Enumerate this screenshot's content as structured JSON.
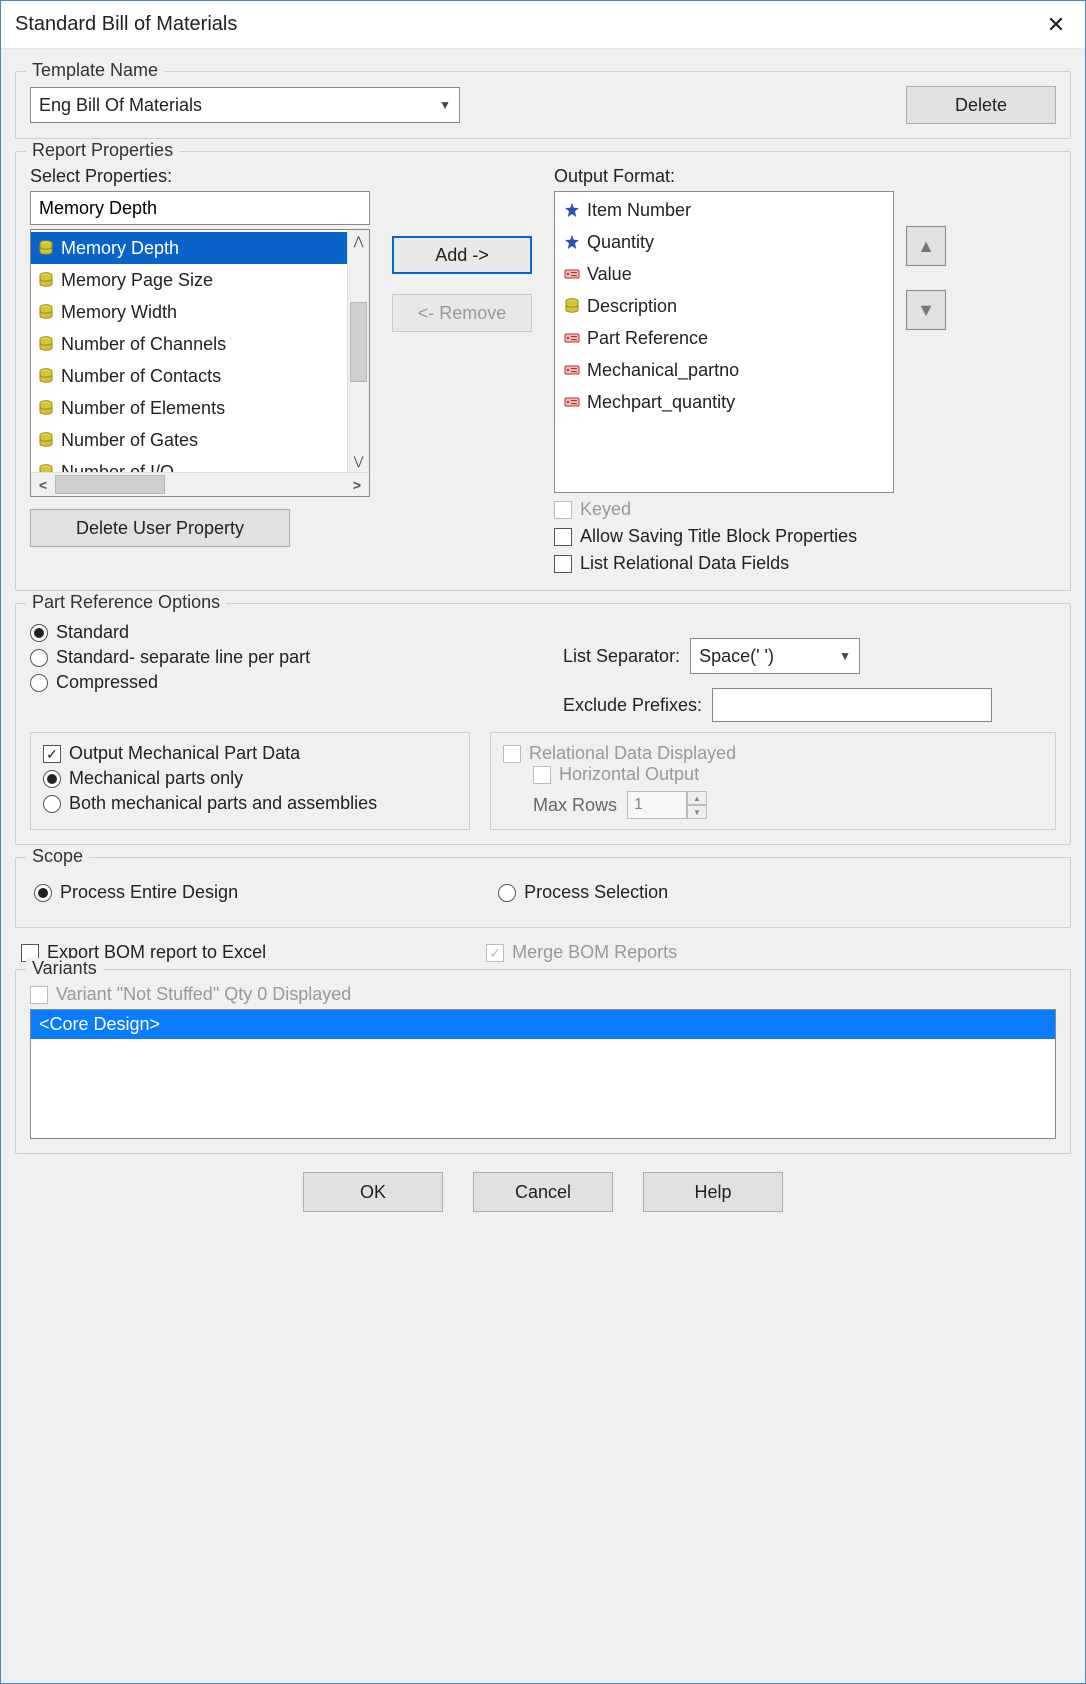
{
  "window": {
    "title": "Standard Bill of Materials"
  },
  "template": {
    "group_label": "Template Name",
    "value": "Eng Bill Of Materials",
    "delete_label": "Delete"
  },
  "report": {
    "group_label": "Report Properties",
    "select_label": "Select Properties:",
    "search_value": "Memory Depth",
    "items": [
      "Memory Depth",
      "Memory Page Size",
      "Memory Width",
      "Number of Channels",
      "Number of Contacts",
      "Number of Elements",
      "Number of Gates",
      "Number of I/O"
    ],
    "selected_index": 0,
    "add_label": "Add ->",
    "remove_label": "<- Remove",
    "output_label": "Output Format:",
    "output_items": [
      {
        "icon": "star",
        "label": "Item Number"
      },
      {
        "icon": "star",
        "label": "Quantity"
      },
      {
        "icon": "tag",
        "label": "Value"
      },
      {
        "icon": "db",
        "label": "Description"
      },
      {
        "icon": "tag",
        "label": "Part Reference"
      },
      {
        "icon": "tag",
        "label": "Mechanical_partno"
      },
      {
        "icon": "tag",
        "label": "Mechpart_quantity"
      }
    ],
    "delete_user_prop_label": "Delete User Property",
    "keyed_label": "Keyed",
    "allow_title_label": "Allow Saving Title Block Properties",
    "list_rel_label": "List Relational Data Fields"
  },
  "partref": {
    "group_label": "Part Reference Options",
    "standard_label": "Standard",
    "sep_line_label": "Standard- separate line per part",
    "compressed_label": "Compressed",
    "list_sep_label": "List Separator:",
    "list_sep_value": "Space(' ')",
    "exclude_label": "Exclude Prefixes:",
    "exclude_value": "",
    "out_mech_label": "Output Mechanical Part Data",
    "mech_only_label": "Mechanical parts only",
    "both_label": "Both mechanical parts and assemblies",
    "rel_disp_label": "Relational Data Displayed",
    "horiz_label": "Horizontal Output",
    "maxrows_label": "Max Rows",
    "maxrows_value": "1"
  },
  "scope": {
    "group_label": "Scope",
    "entire_label": "Process Entire Design",
    "selection_label": "Process Selection"
  },
  "export": {
    "export_label": "Export BOM report to Excel",
    "merge_label": "Merge BOM Reports"
  },
  "variants": {
    "group_label": "Variants",
    "not_stuffed_label": "Variant \"Not Stuffed\" Qty 0 Displayed",
    "items": [
      "<Core Design>"
    ]
  },
  "buttons": {
    "ok": "OK",
    "cancel": "Cancel",
    "help": "Help"
  }
}
